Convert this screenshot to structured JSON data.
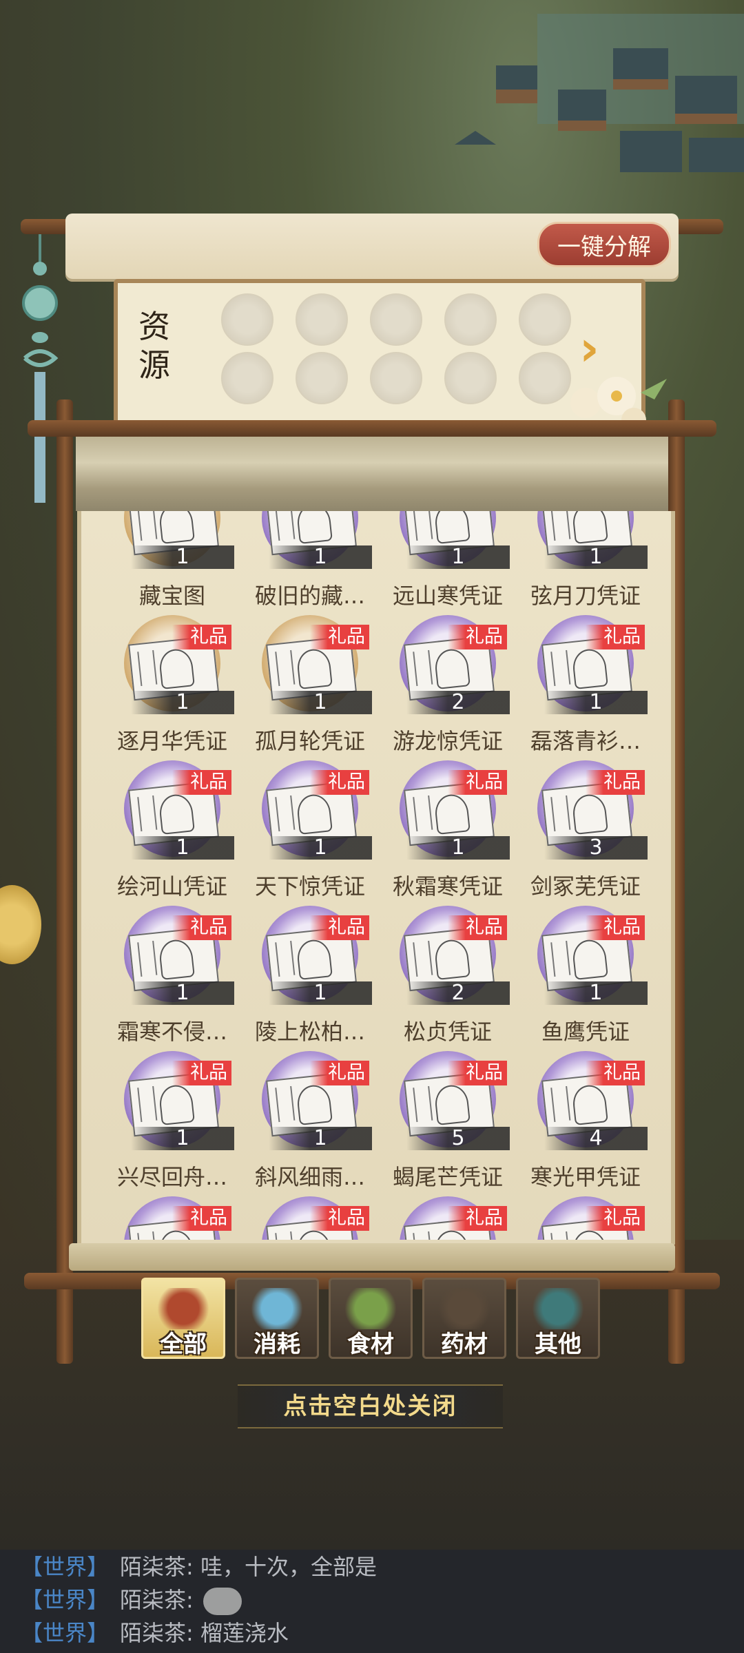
{
  "header": {
    "decompose_label": "一键分解"
  },
  "resource": {
    "label": "资源",
    "slot_count": 10,
    "arrow_icon": "chevron-right-icon"
  },
  "items": [
    {
      "name": "藏宝图",
      "count": "1",
      "gift": false,
      "frame": "gold"
    },
    {
      "name": "破旧的藏…",
      "count": "1",
      "gift": false,
      "frame": "purple"
    },
    {
      "name": "远山寒凭证",
      "count": "1",
      "gift": false,
      "frame": "purple"
    },
    {
      "name": "弦月刀凭证",
      "count": "1",
      "gift": false,
      "frame": "purple"
    },
    {
      "name": "逐月华凭证",
      "count": "1",
      "gift": true,
      "frame": "gold"
    },
    {
      "name": "孤月轮凭证",
      "count": "1",
      "gift": true,
      "frame": "gold"
    },
    {
      "name": "游龙惊凭证",
      "count": "2",
      "gift": true,
      "frame": "purple"
    },
    {
      "name": "磊落青衫…",
      "count": "1",
      "gift": true,
      "frame": "purple"
    },
    {
      "name": "绘河山凭证",
      "count": "1",
      "gift": true,
      "frame": "purple"
    },
    {
      "name": "天下惊凭证",
      "count": "1",
      "gift": true,
      "frame": "purple"
    },
    {
      "name": "秋霜寒凭证",
      "count": "1",
      "gift": true,
      "frame": "purple"
    },
    {
      "name": "剑冢芜凭证",
      "count": "3",
      "gift": true,
      "frame": "purple"
    },
    {
      "name": "霜寒不侵…",
      "count": "1",
      "gift": true,
      "frame": "purple"
    },
    {
      "name": "陵上松柏…",
      "count": "1",
      "gift": true,
      "frame": "purple"
    },
    {
      "name": "松贞凭证",
      "count": "2",
      "gift": true,
      "frame": "purple"
    },
    {
      "name": "鱼鹰凭证",
      "count": "1",
      "gift": true,
      "frame": "purple"
    },
    {
      "name": "兴尽回舟…",
      "count": "1",
      "gift": true,
      "frame": "purple"
    },
    {
      "name": "斜风细雨…",
      "count": "1",
      "gift": true,
      "frame": "purple"
    },
    {
      "name": "蝎尾芒凭证",
      "count": "5",
      "gift": true,
      "frame": "purple"
    },
    {
      "name": "寒光甲凭证",
      "count": "4",
      "gift": true,
      "frame": "purple"
    },
    {
      "name": "",
      "count": "",
      "gift": true,
      "frame": "purple"
    },
    {
      "name": "",
      "count": "",
      "gift": true,
      "frame": "purple"
    },
    {
      "name": "",
      "count": "",
      "gift": true,
      "frame": "purple"
    },
    {
      "name": "",
      "count": "",
      "gift": true,
      "frame": "purple"
    }
  ],
  "gift_label": "礼品",
  "tabs": [
    {
      "label": "全部",
      "icon": "treasure-chest-icon",
      "active": true
    },
    {
      "label": "消耗",
      "icon": "potion-bottle-icon",
      "active": false
    },
    {
      "label": "食材",
      "icon": "vegetable-basket-icon",
      "active": false
    },
    {
      "label": "药材",
      "icon": "herb-pot-icon",
      "active": false
    },
    {
      "label": "其他",
      "icon": "treasure-urn-icon",
      "active": false
    }
  ],
  "close_hint": "点击空白处关闭",
  "chat": [
    {
      "channel": "【世界】",
      "speaker": "陌柒茶:",
      "message": "哇，十次，全部是",
      "emoji": false
    },
    {
      "channel": "【世界】",
      "speaker": "陌柒茶:",
      "message": "",
      "emoji": true
    },
    {
      "channel": "【世界】",
      "speaker": "陌柒茶:",
      "message": "榴莲浇水",
      "emoji": false
    }
  ],
  "colors": {
    "gift_red": "#e84040",
    "chat_channel": "#4a86c7",
    "hint_gold": "#f2d98b",
    "active_tab": "#d9b759"
  }
}
